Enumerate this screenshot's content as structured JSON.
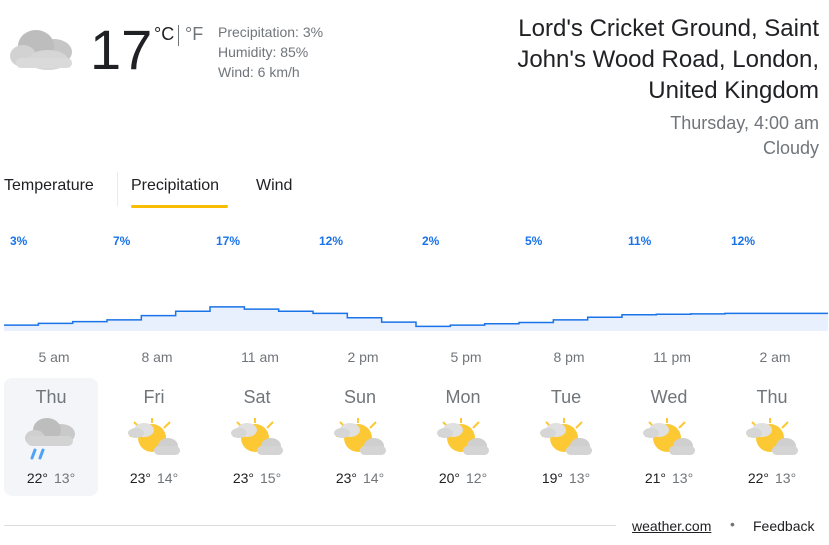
{
  "current": {
    "temperature": "17",
    "unit_c": "°C",
    "unit_f": "°F",
    "precipitation": "Precipitation: 3%",
    "humidity": "Humidity: 85%",
    "wind": "Wind: 6 km/h",
    "icon": "cloudy-icon"
  },
  "location": {
    "name": "Lord's Cricket Ground, Saint John's Wood Road, London, United Kingdom",
    "datetime": "Thursday, 4:00 am",
    "condition": "Cloudy"
  },
  "tabs": [
    {
      "label": "Temperature",
      "active": false
    },
    {
      "label": "Precipitation",
      "active": true
    },
    {
      "label": "Wind",
      "active": false
    }
  ],
  "chart_data": {
    "type": "area",
    "labels": [
      "3%",
      "7%",
      "17%",
      "12%",
      "2%",
      "5%",
      "11%",
      "12%"
    ],
    "values": [
      3,
      7,
      17,
      12,
      2,
      5,
      11,
      12
    ],
    "x": [
      "5 am",
      "8 am",
      "11 am",
      "2 pm",
      "5 pm",
      "8 pm",
      "11 pm",
      "2 am"
    ],
    "fill_color": "#e8f0fe",
    "line_color": "#1a73e8",
    "label_color": "#1a73e8"
  },
  "days": [
    {
      "name": "Thu",
      "high": "22°",
      "low": "13°",
      "icon": "rain-cloud-icon",
      "selected": true
    },
    {
      "name": "Fri",
      "high": "23°",
      "low": "14°",
      "icon": "partly-cloudy-icon",
      "selected": false
    },
    {
      "name": "Sat",
      "high": "23°",
      "low": "15°",
      "icon": "partly-cloudy-icon",
      "selected": false
    },
    {
      "name": "Sun",
      "high": "23°",
      "low": "14°",
      "icon": "partly-cloudy-icon",
      "selected": false
    },
    {
      "name": "Mon",
      "high": "20°",
      "low": "12°",
      "icon": "partly-cloudy-icon",
      "selected": false
    },
    {
      "name": "Tue",
      "high": "19°",
      "low": "13°",
      "icon": "partly-cloudy-icon",
      "selected": false
    },
    {
      "name": "Wed",
      "high": "21°",
      "low": "13°",
      "icon": "partly-cloudy-icon",
      "selected": false
    },
    {
      "name": "Thu",
      "high": "22°",
      "low": "13°",
      "icon": "partly-cloudy-icon",
      "selected": false
    }
  ],
  "footer": {
    "source": "weather.com",
    "separator": "•",
    "feedback": "Feedback"
  }
}
